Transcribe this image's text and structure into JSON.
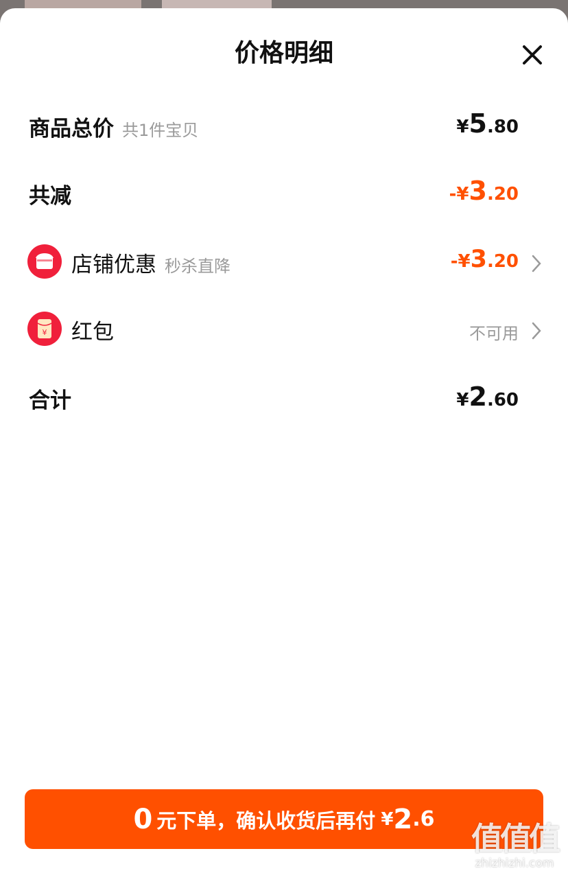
{
  "header": {
    "title": "价格明细"
  },
  "rows": {
    "total": {
      "label": "商品总价",
      "sub": "共1件宝贝",
      "currency": "¥",
      "int": "5",
      "dec": ".80"
    },
    "discount": {
      "label": "共减",
      "currency": "-¥",
      "int": "3",
      "dec": ".20"
    },
    "store": {
      "label": "店铺优惠",
      "sub": "秒杀直降",
      "currency": "-¥",
      "int": "3",
      "dec": ".20"
    },
    "redpacket": {
      "label": "红包",
      "status": "不可用",
      "icon_glyph": "¥"
    },
    "sum": {
      "label": "合计",
      "currency": "¥",
      "int": "2",
      "dec": ".60"
    }
  },
  "pay_button": {
    "zero": "0",
    "text": "元下单，确认收货后再付",
    "currency": "¥",
    "int": "2",
    "dec": ".6"
  },
  "watermark": {
    "logo": "值值值",
    "url": "zhizhizhi.com"
  },
  "icons": [
    "close-icon",
    "store-icon",
    "red-packet-icon",
    "chevron-right-icon"
  ],
  "colors": {
    "accent": "#ff5000",
    "store_icon": "#f0203b",
    "muted": "#9a9a9a"
  }
}
